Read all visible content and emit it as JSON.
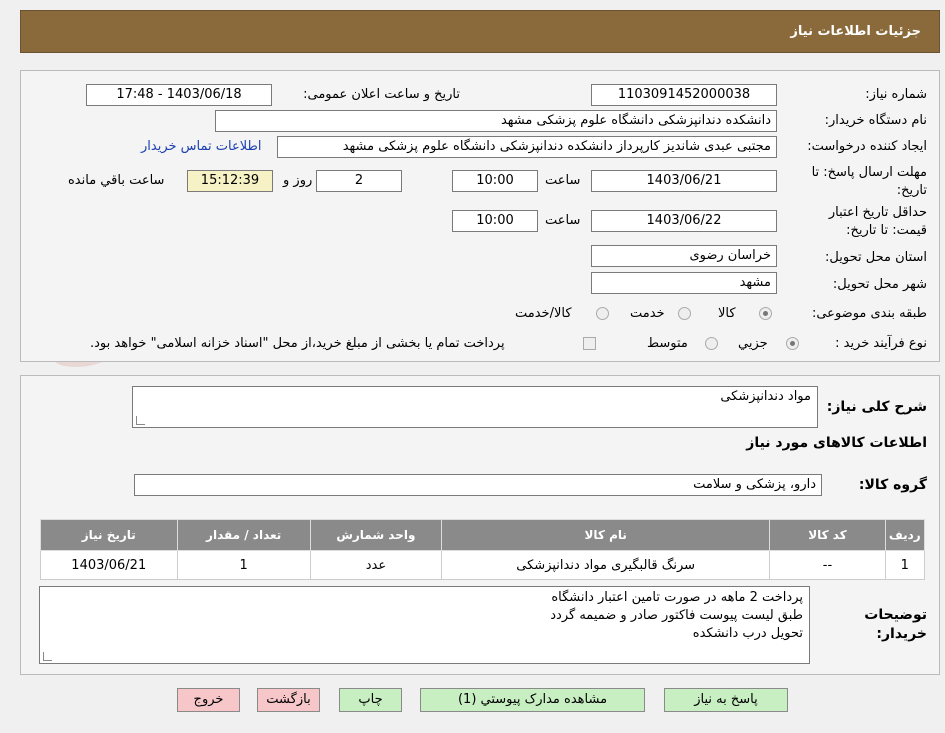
{
  "header": {
    "title": "جزئیات اطلاعات نیاز"
  },
  "need_number": {
    "label": "شماره نیاز:",
    "value": "1103091452000038"
  },
  "announce_datetime": {
    "label": "تاریخ و ساعت اعلان عمومی:",
    "value": "1403/06/18 - 17:48"
  },
  "buyer_org": {
    "label": "نام دستگاه خریدار:",
    "value": "دانشکده دندانپزشکی   دانشگاه علوم پزشکی مشهد"
  },
  "requester": {
    "label": "ایجاد کننده درخواست:",
    "value": "مجتبی عبدی شاندیز کارپرداز دانشکده دندانپزشکی   دانشگاه علوم پزشکی مشهد",
    "contact_link": "اطلاعات تماس خریدار"
  },
  "reply_deadline": {
    "label_line1": "مهلت ارسال پاسخ: تا",
    "label_line2": "تاریخ:",
    "date": "1403/06/21",
    "time_label": "ساعت",
    "time": "10:00",
    "days": "2",
    "days_label": "روز و",
    "remaining": "15:12:39",
    "remaining_label": "ساعت باقي مانده"
  },
  "price_validity": {
    "label_line1": "حداقل تاريخ اعتبار",
    "label_line2": "قيمت: تا تاريخ:",
    "date": "1403/06/22",
    "time_label": "ساعت",
    "time": "10:00"
  },
  "province": {
    "label": "استان محل تحویل:",
    "value": "خراسان رضوی"
  },
  "city": {
    "label": "شهر محل تحویل:",
    "value": "مشهد"
  },
  "category": {
    "label": "طبقه بندی موضوعی:",
    "options": [
      "کالا",
      "خدمت",
      "کالا/خدمت"
    ],
    "selected": "کالا"
  },
  "purchase_type": {
    "label": "نوع فرآیند خرید :",
    "options": [
      "جزیي",
      "متوسط"
    ],
    "selected": "جزیي",
    "treasury_note": "پرداخت تمام یا بخشی از مبلغ خرید،از محل \"اسناد خزانه اسلامی\" خواهد بود."
  },
  "description": {
    "label": "شرح کلی نیاز:",
    "value": "مواد دندانپزشکی"
  },
  "goods_section": {
    "title": "اطلاعات کالاهای مورد نیاز"
  },
  "goods_group": {
    "label": "گروه کالا:",
    "value": "دارو، پزشکی و سلامت"
  },
  "table": {
    "headers": [
      "ردیف",
      "کد کالا",
      "نام کالا",
      "واحد شمارش",
      "تعداد / مقدار",
      "تاریخ نیاز"
    ],
    "rows": [
      [
        "1",
        "--",
        "سرنگ قالبگیری مواد دندانپزشکی",
        "عدد",
        "1",
        "1403/06/21"
      ]
    ]
  },
  "buyer_notes": {
    "label_line1": "توضیحات",
    "label_line2": "خریدار:",
    "lines": [
      "پرداخت 2 ماهه در صورت تامین اعتبار دانشگاه",
      "طبق لیست پیوست فاکتور صادر و ضمیمه گردد",
      "تحویل درب دانشکده"
    ]
  },
  "buttons": {
    "reply": "پاسخ به نیاز",
    "attachments": "مشاهده مدارک پیوستي (1)",
    "print": "چاپ",
    "back": "بازگشت",
    "exit": "خروج"
  },
  "watermark": {
    "text": "AriaTender.neT"
  },
  "colors": {
    "header_bg": "#8a6a3b",
    "button_green": "#c7efc1",
    "button_pink": "#f6c6c9",
    "table_header": "#8a8a8a",
    "link": "#1a3fb0"
  }
}
